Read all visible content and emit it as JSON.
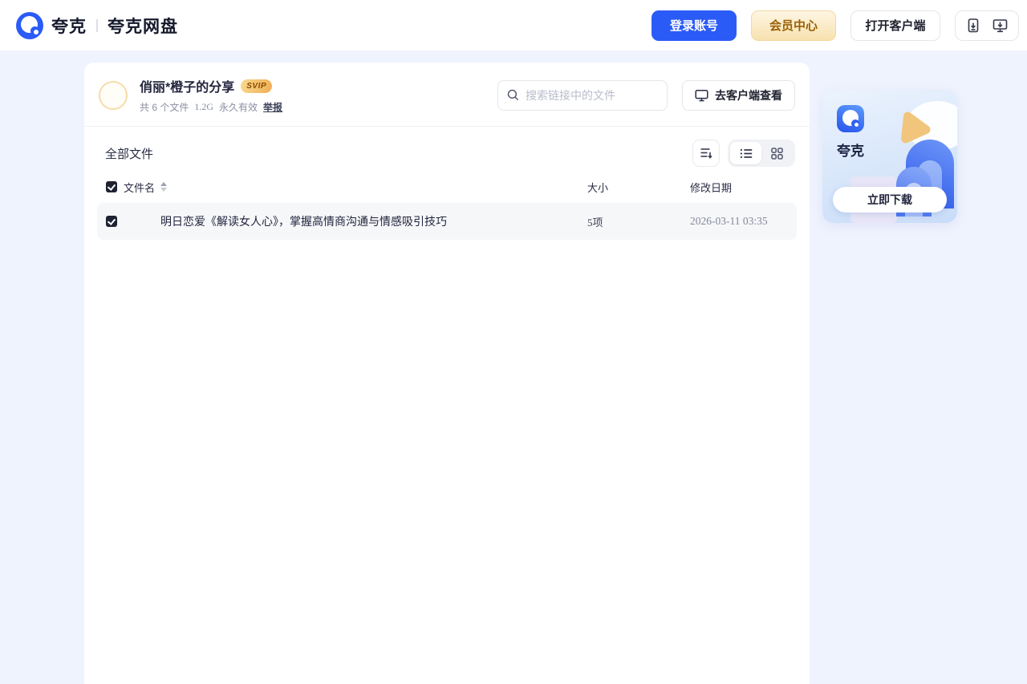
{
  "header": {
    "brand": "夸克",
    "product": "夸克网盘",
    "login_button": "登录账号",
    "vip_button": "会员中心",
    "open_client_button": "打开客户端"
  },
  "share": {
    "owner_name": "俏丽*橙子的分享",
    "badge": "SVIP",
    "stats": {
      "files": "共 6 个文件",
      "size": "1.2G",
      "validity": "永久有效",
      "report": "举报"
    },
    "search_placeholder": "搜索链接中的文件",
    "client_view_button": "去客户端查看"
  },
  "files": {
    "section_title": "全部文件",
    "columns": {
      "name": "文件名",
      "size": "大小",
      "date": "修改日期"
    },
    "rows": [
      {
        "name": "明日恋爱《解读女人心》，掌握高情商沟通与情感吸引技巧",
        "size": "5项",
        "date": "2026-03-11 03:35",
        "checked": true
      }
    ]
  },
  "promo": {
    "app_name": "夸克",
    "download_button": "立即下载"
  },
  "colors": {
    "accent_blue": "#2B5BF7",
    "vip_gold_bg": "#F7E1AE",
    "vip_gold_text": "#9A6206",
    "page_background": "#EFF3FE",
    "row_background": "#F6F7F9",
    "text_dark": "#23253D",
    "text_gray": "#8A8EA3"
  }
}
